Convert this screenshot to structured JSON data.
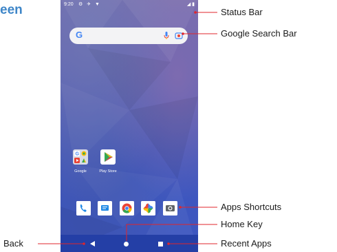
{
  "page": {
    "title_fragment": "een"
  },
  "status_bar": {
    "time": "9:20"
  },
  "apps": [
    {
      "name": "google-folder",
      "label": "Google"
    },
    {
      "name": "play-store",
      "label": "Play Store"
    }
  ],
  "dock": [
    "phone-icon",
    "messages-icon",
    "chrome-icon",
    "photos-icon",
    "camera-icon"
  ],
  "callouts": {
    "status_bar": "Status Bar",
    "search_bar": "Google Search Bar",
    "apps_shortcuts": "Apps Shortcuts",
    "home_key": "Home Key",
    "recent_apps": "Recent Apps",
    "back": "Back"
  },
  "colors": {
    "accent": "#3e86c8",
    "callout_line": "#e0252b",
    "navbar": "#243fa6"
  }
}
